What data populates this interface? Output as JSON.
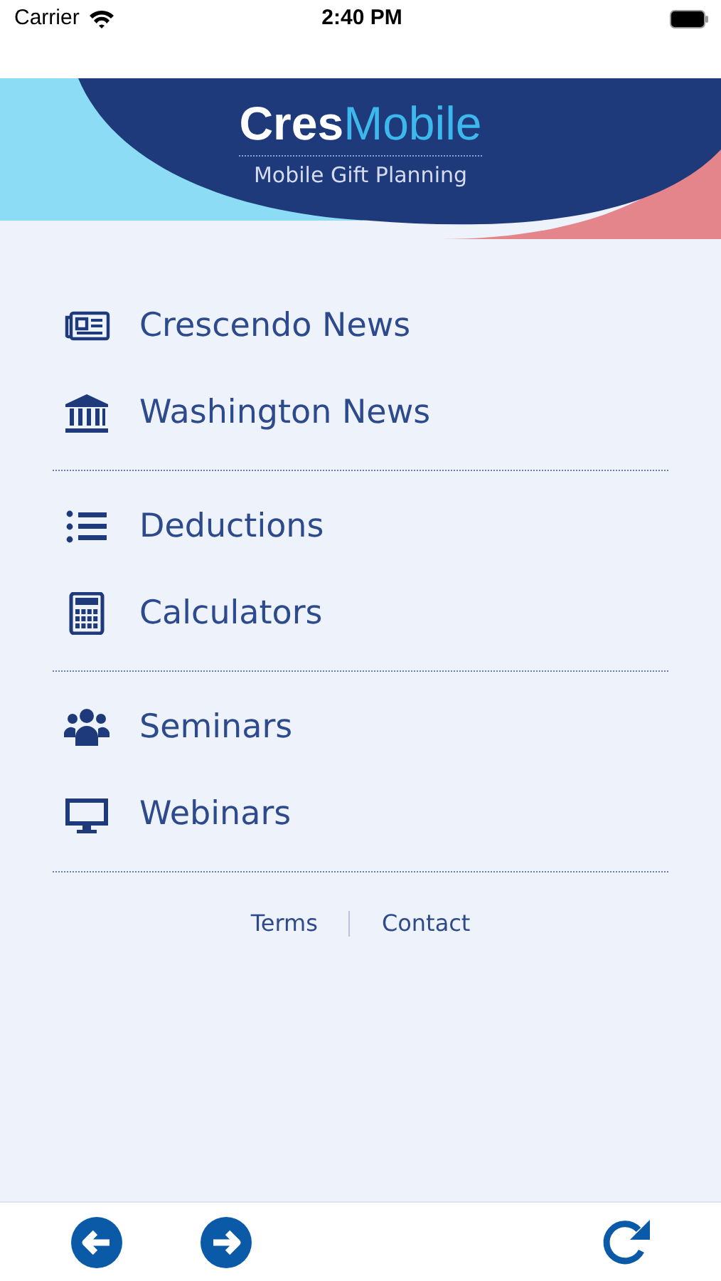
{
  "status_bar": {
    "carrier": "Carrier",
    "time": "2:40 PM"
  },
  "header": {
    "logo_bold": "Cres",
    "logo_light": "Mobile",
    "tagline": "Mobile Gift Planning"
  },
  "menu_groups": [
    [
      {
        "label": "Crescendo News",
        "kind": "newspaper"
      },
      {
        "label": "Washington News",
        "kind": "bank"
      }
    ],
    [
      {
        "label": "Deductions",
        "kind": "list"
      },
      {
        "label": "Calculators",
        "kind": "calculator"
      }
    ],
    [
      {
        "label": "Seminars",
        "kind": "people"
      },
      {
        "label": "Webinars",
        "kind": "monitor"
      }
    ]
  ],
  "footer_links": [
    "Terms",
    "Contact"
  ],
  "toolbar": [
    {
      "kind": "back"
    },
    {
      "kind": "forward"
    },
    {
      "kind": "reload"
    }
  ]
}
